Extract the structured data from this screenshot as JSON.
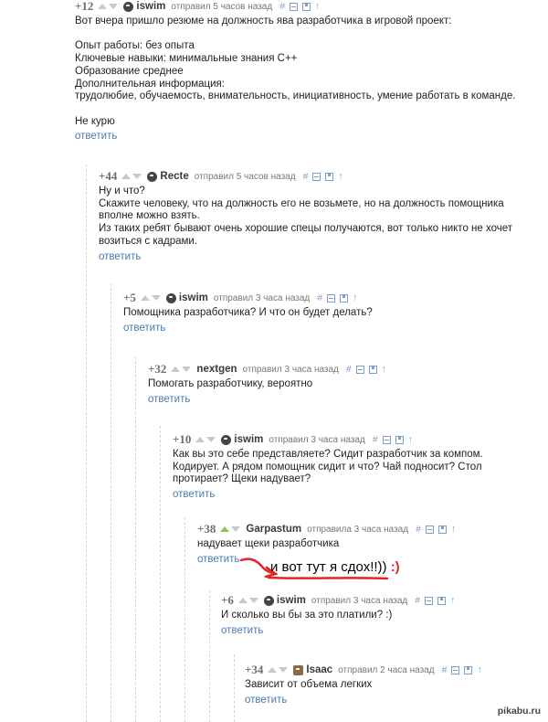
{
  "reply_label": "ответить",
  "comments": [
    {
      "score": "+12",
      "user": "iswim",
      "meta": "отправил 5 часов назад",
      "body": "Вот вчера пришло резюме на должность ява разработчика в игровой проект:\n\nОпыт работы: без опыта\nКлючевые навыки: минимальные знания С++\nОбразование среднее\nДополнительная информация:\nтрудолюбие, обучаемость, внимательность, инициативность, умение работать в команде.\n\nНе курю"
    },
    {
      "score": "+44",
      "user": "Recte",
      "meta": "отправил 5 часов назад",
      "body": "Ну и что?\nСкажите человеку, что на должность его не возьмете, но на должность помощника\nвполне можно взять.\nИз таких ребят бывают очень хорошие спецы получаются, вот только никто не хочет\nвозиться с кадрами."
    },
    {
      "score": "+5",
      "user": "iswim",
      "meta": "отправил 3 часа назад",
      "body": "Помощника разработчика? И что он будет делать?"
    },
    {
      "score": "+32",
      "user": "nextgen",
      "meta": "отправил 3 часа назад",
      "body": "Помогать разработчику, вероятно"
    },
    {
      "score": "+10",
      "user": "iswim",
      "meta": "отправил 3 часа назад",
      "body": "Как вы это себе представляете? Сидит разработчик за компом.\nКодирует. А рядом помощник сидит и что? Чай подносит? Стол\nпротирает? Щеки надувает?"
    },
    {
      "score": "+38",
      "user": "Garpastum",
      "meta": "отправила 3 часа назад",
      "body": "надувает щеки разработчика"
    },
    {
      "score": "+6",
      "user": "iswim",
      "meta": "отправил 3 часа назад",
      "body": "И сколько вы бы за это платили? :)"
    },
    {
      "score": "+34",
      "user": "Isaac",
      "meta": "отправил 2 часа назад",
      "body": "Зависит от объема легких"
    }
  ],
  "annotation": {
    "text": "и вот тут я сдох!!))",
    "smile": ":)"
  },
  "watermark": "pikabu.ru",
  "colors": {
    "accent_link": "#4a79ae",
    "annotation_red": "#e52525",
    "upvote_green": "#8dc54a"
  }
}
